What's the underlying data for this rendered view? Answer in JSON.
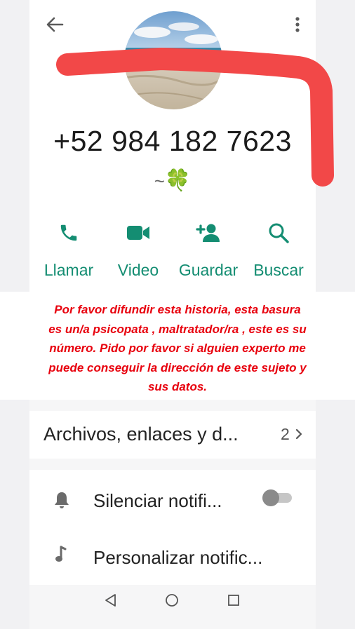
{
  "contact": {
    "phone": "+52 984 182 7623",
    "status_tilde": "~",
    "status_emoji": "🍀",
    "avatar_description": "beach photo"
  },
  "actions": [
    {
      "label": "Llamar",
      "icon": "phone-icon"
    },
    {
      "label": "Video",
      "icon": "video-camera-icon"
    },
    {
      "label": "Guardar",
      "icon": "add-person-icon"
    },
    {
      "label": "Buscar",
      "icon": "search-icon"
    }
  ],
  "overlay_message": {
    "lines": [
      "Por favor difundir esta historia, esta basura",
      "es un/a psicopata , maltratador/ra , este es su",
      "número. Pido por favor si alguien experto me",
      "puede conseguir la dirección de este sujeto y",
      "sus datos."
    ],
    "color": "#e8000d"
  },
  "files": {
    "label": "Archivos, enlaces y d...",
    "count": "2"
  },
  "settings": {
    "mute_label": "Silenciar notifi...",
    "mute_enabled": false,
    "custom_label": "Personalizar notific..."
  },
  "colors": {
    "accent": "#148d72",
    "scribble": "#f24848"
  }
}
